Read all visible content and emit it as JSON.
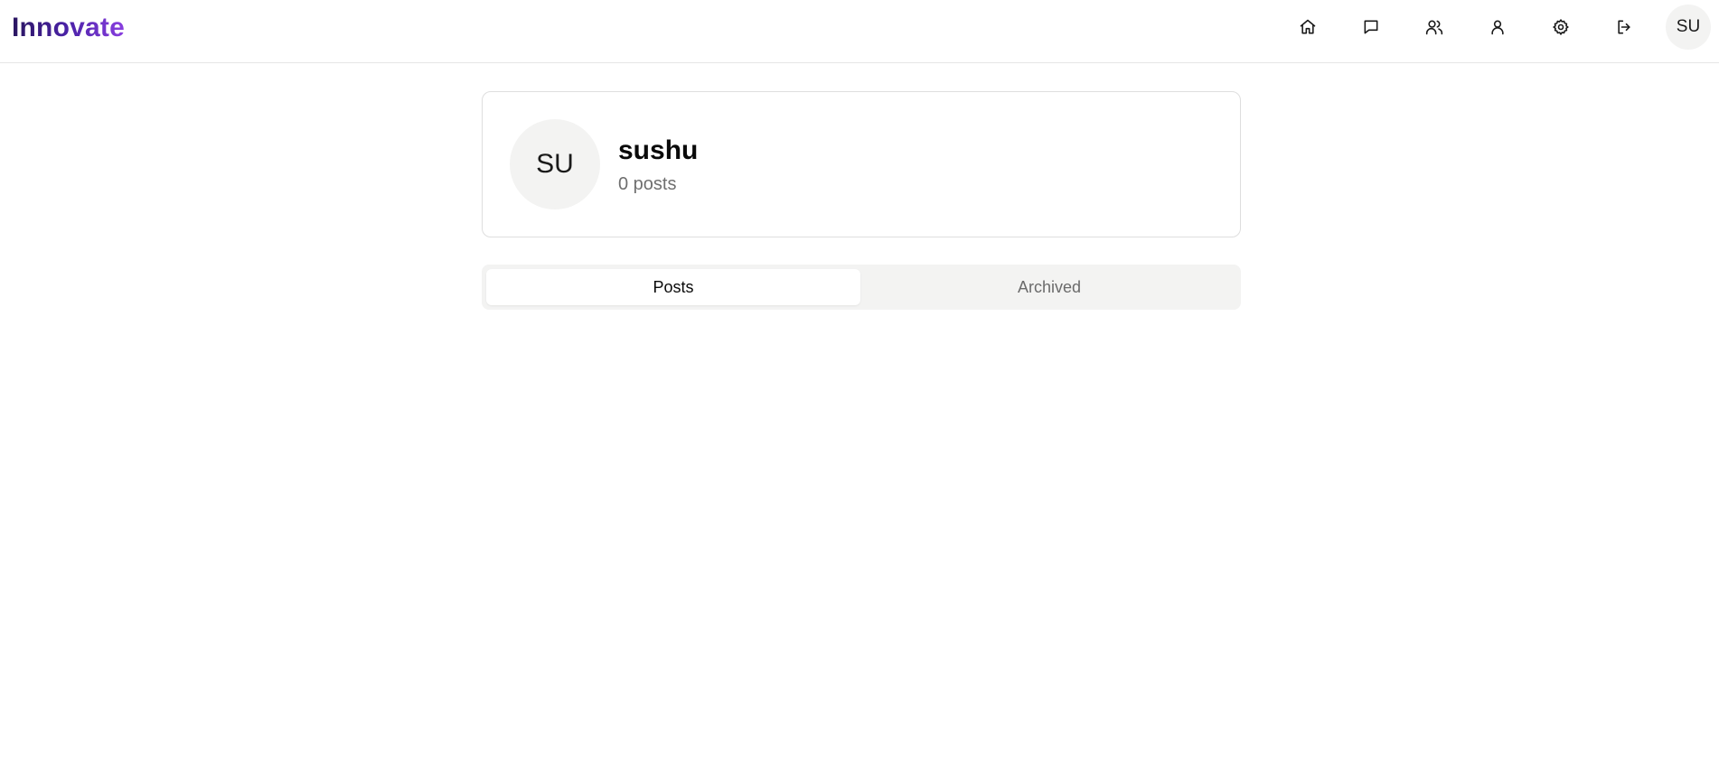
{
  "header": {
    "logo": "Innovate",
    "nav_icons": [
      "home-icon",
      "message-icon",
      "users-icon",
      "user-icon",
      "settings-icon",
      "logout-icon"
    ],
    "avatar_initials": "SU"
  },
  "profile": {
    "avatar_initials": "SU",
    "username": "sushu",
    "post_count_text": "0 posts"
  },
  "tabs": {
    "items": [
      {
        "label": "Posts",
        "active": true
      },
      {
        "label": "Archived",
        "active": false
      }
    ]
  },
  "colors": {
    "logo_gradient_start": "#2a1660",
    "logo_gradient_end": "#8a3fe0",
    "surface_muted": "#f3f3f2",
    "border": "#dedede"
  }
}
